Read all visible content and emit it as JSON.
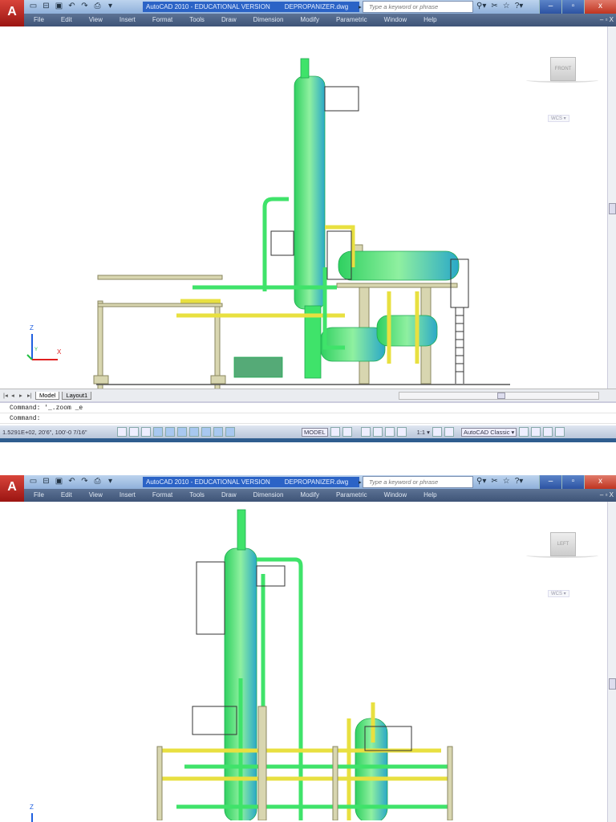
{
  "app": {
    "logo": "A",
    "title": "AutoCAD 2010 - EDUCATIONAL VERSION",
    "filename": "DEPROPANIZER.dwg",
    "search_placeholder": "Type a keyword or phrase"
  },
  "menu": [
    "File",
    "Edit",
    "View",
    "Insert",
    "Format",
    "Tools",
    "Draw",
    "Dimension",
    "Modify",
    "Parametric",
    "Window",
    "Help"
  ],
  "window_buttons": [
    "–",
    "▫",
    "x"
  ],
  "views": [
    {
      "viewcube": "FRONT",
      "wcs": "WCS ▾"
    },
    {
      "viewcube": "LEFT",
      "wcs": "WCS ▾"
    }
  ],
  "ucs": {
    "x": "X",
    "y": "Y",
    "z": "Z"
  },
  "tabs": [
    "Model",
    "Layout1"
  ],
  "command_lines": [
    "Command: '_.zoom _e",
    "Command:"
  ],
  "status": {
    "coords": "1.5291E+02, 20'6\", 100'-0 7/16\"",
    "model": "MODEL",
    "scale": "1:1 ▾",
    "workspace": "AutoCAD Classic ▾"
  },
  "colors": {
    "accent": "#2b63c6",
    "equipment": "#3fe36a",
    "steel": "#d8d6b0",
    "pipe_yellow": "#e8e040"
  }
}
